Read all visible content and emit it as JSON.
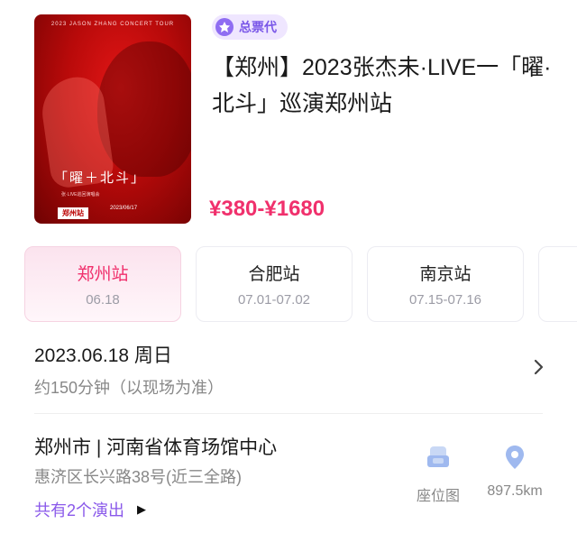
{
  "poster": {
    "tour_text": "2023 JASON ZHANG CONCERT TOUR",
    "title_text": "「曜＋北斗」",
    "sub_text": "张·LIVE巡回演唱会",
    "city_text": "郑州站",
    "date_text": "2023/06/17"
  },
  "agent_badge": {
    "label": "总票代"
  },
  "event": {
    "title": "【郑州】2023张杰未·LIVE一「曜·北斗」巡演郑州站",
    "price": "¥380-¥1680"
  },
  "city_tabs": [
    {
      "name": "郑州站",
      "date": "06.18"
    },
    {
      "name": "合肥站",
      "date": "07.01-07.02"
    },
    {
      "name": "南京站",
      "date": "07.15-07.16"
    }
  ],
  "show": {
    "datetime": "2023.06.18 周日",
    "duration": "约150分钟（以现场为准）"
  },
  "venue": {
    "name": "郑州市 | 河南省体育场馆中心",
    "address": "惠济区长兴路38号(近三全路)",
    "shows_link": "共有2个演出",
    "seat_map_label": "座位图",
    "distance": "897.5km"
  },
  "colors": {
    "accent_pink": "#f0306c",
    "accent_purple": "#8a59ea",
    "badge_bg": "#efe6ff"
  }
}
